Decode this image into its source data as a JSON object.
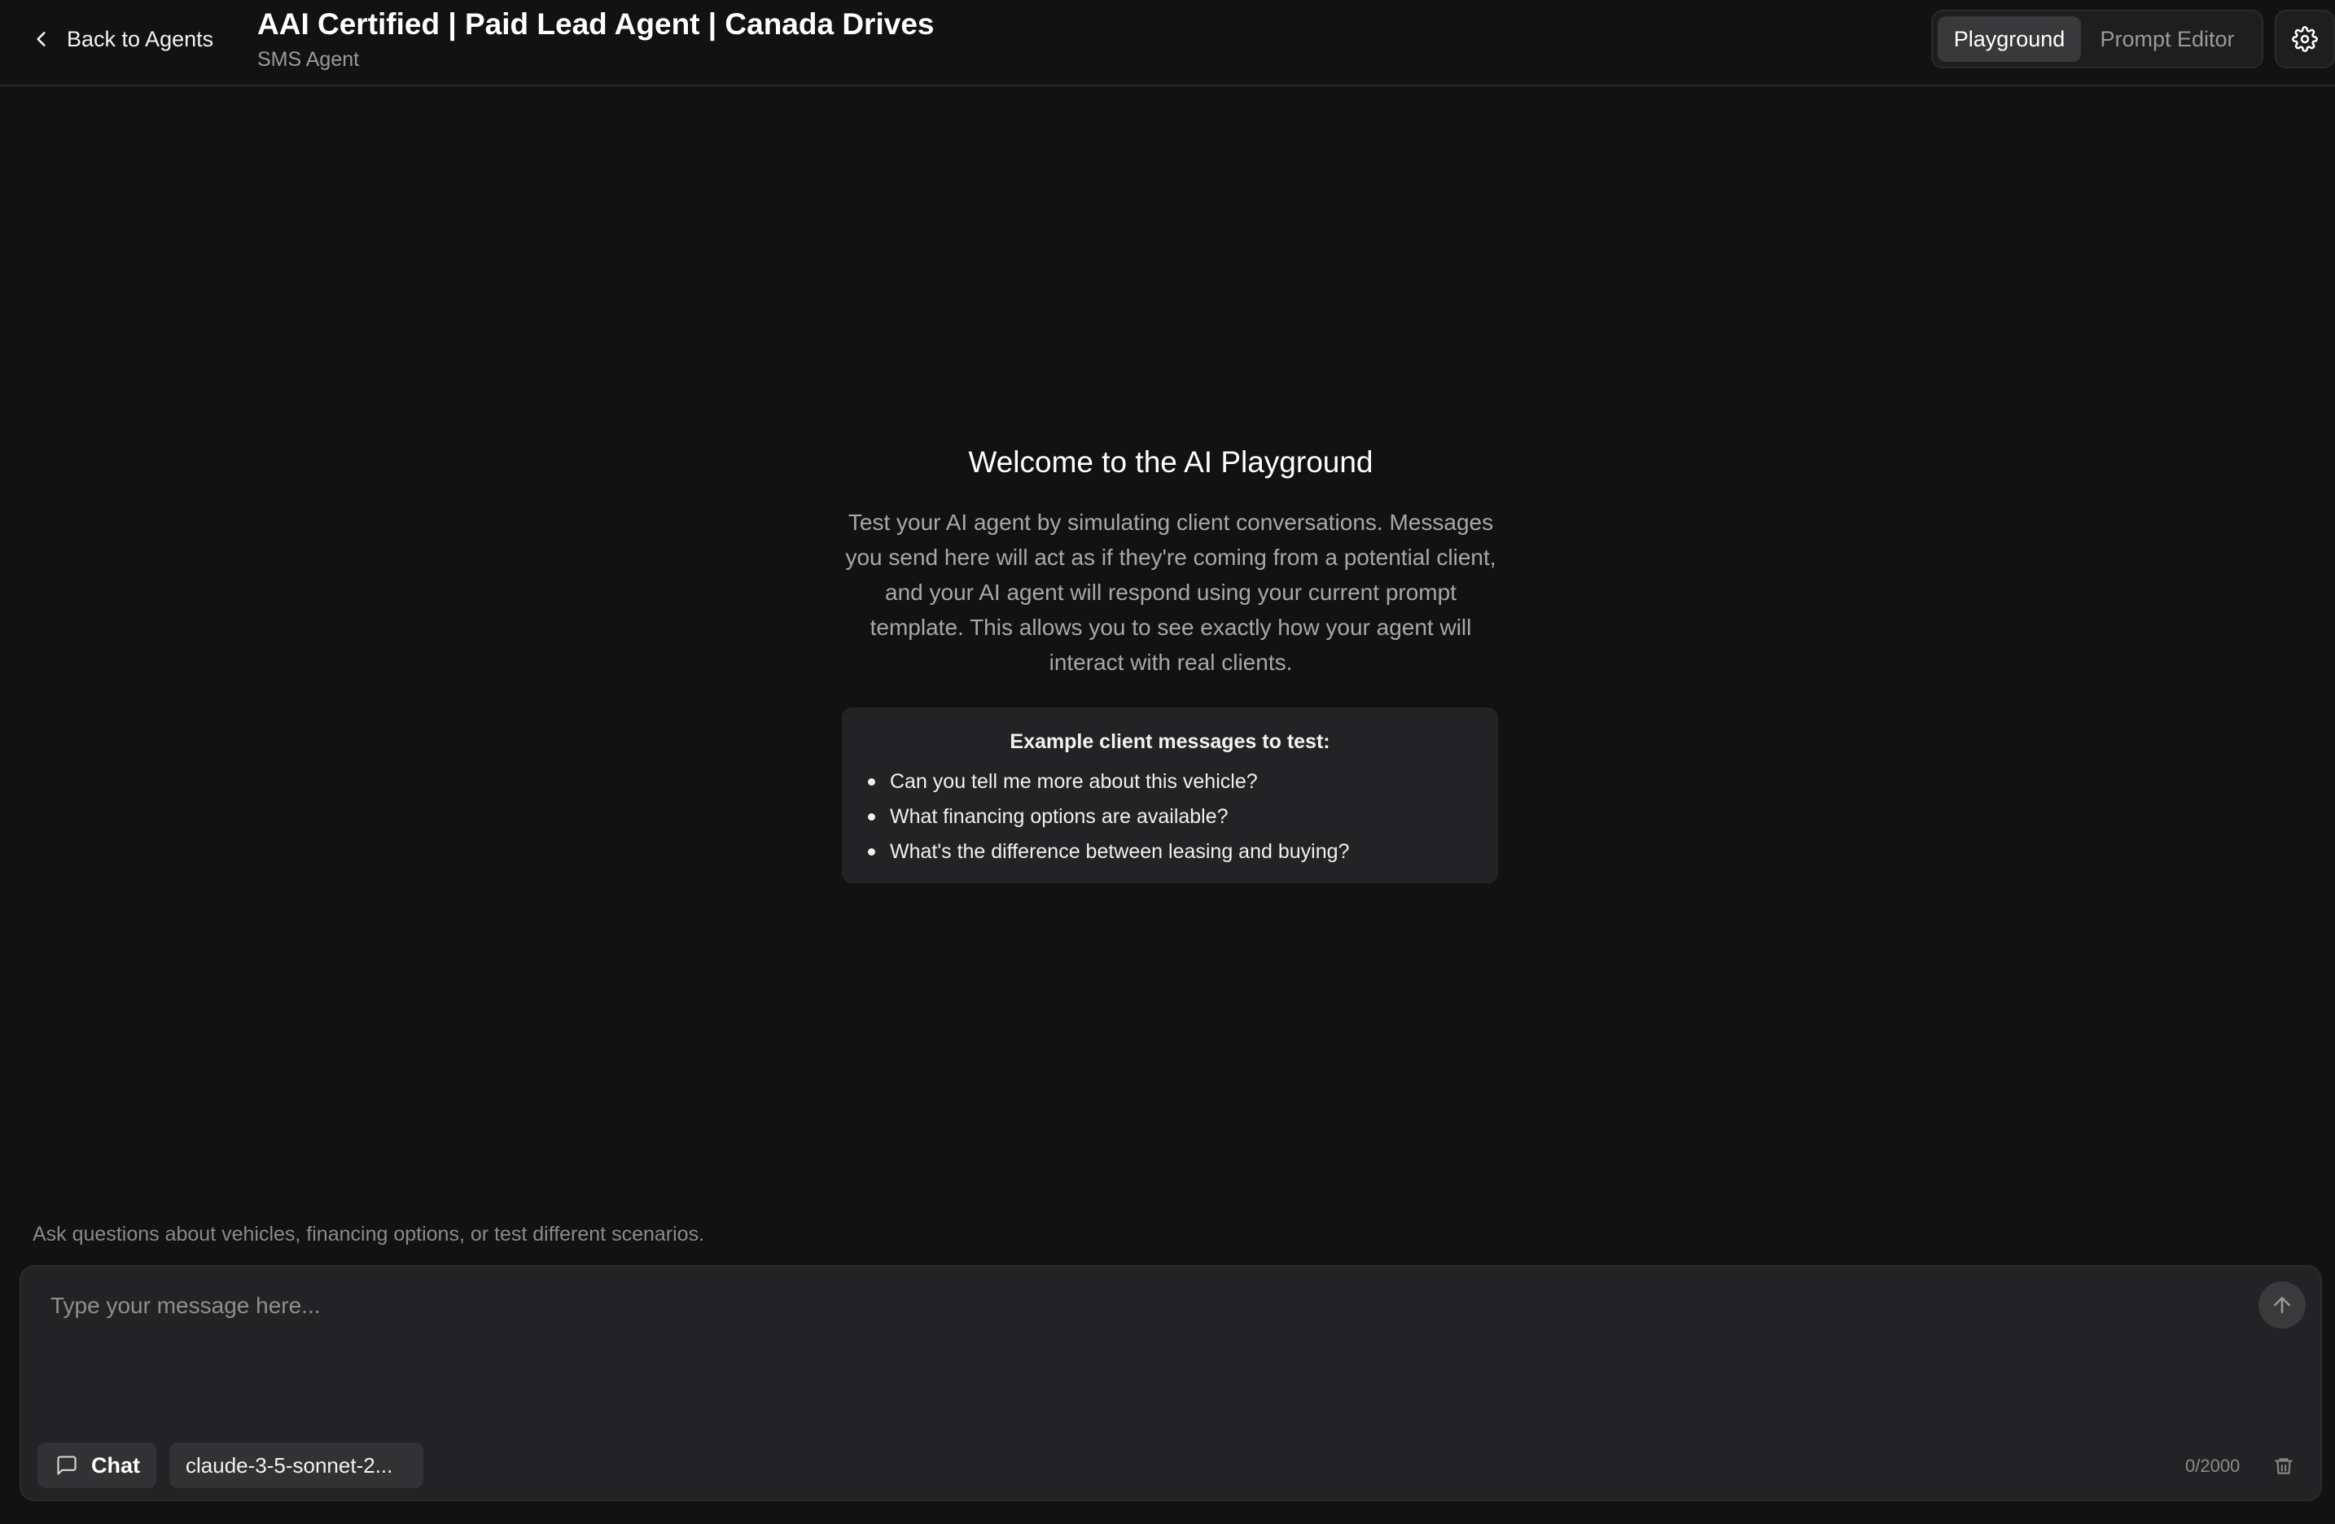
{
  "header": {
    "back_label": "Back to Agents",
    "title": "AAI Certified | Paid Lead Agent | Canada Drives",
    "subtitle": "SMS Agent",
    "tabs": [
      {
        "label": "Playground",
        "active": true
      },
      {
        "label": "Prompt Editor",
        "active": false
      }
    ],
    "icons": {
      "back": "chevron-left-icon",
      "settings": "gear-icon"
    }
  },
  "welcome": {
    "title": "Welcome to the AI Playground",
    "description": "Test your AI agent by simulating client conversations. Messages you send here will act as if they're coming from a potential client, and your AI agent will respond using your current prompt template. This allows you to see exactly how your agent will interact with real clients.",
    "examples_title": "Example client messages to test:",
    "examples": [
      "Can you tell me more about this vehicle?",
      "What financing options are available?",
      "What's the difference between leasing and buying?"
    ]
  },
  "composer": {
    "hint": "Ask questions about vehicles, financing options, or test different scenarios.",
    "placeholder": "Type your message here...",
    "value": "",
    "mode_label": "Chat",
    "model_label": "claude-3-5-sonnet-2...",
    "char_count": "0/2000",
    "icons": {
      "send": "arrow-up-icon",
      "mode": "message-square-icon",
      "clear": "trash-icon"
    }
  },
  "colors": {
    "background": "#121212",
    "panel": "#232325",
    "active_tab": "#39393b",
    "text_muted": "#a8a8a8"
  }
}
